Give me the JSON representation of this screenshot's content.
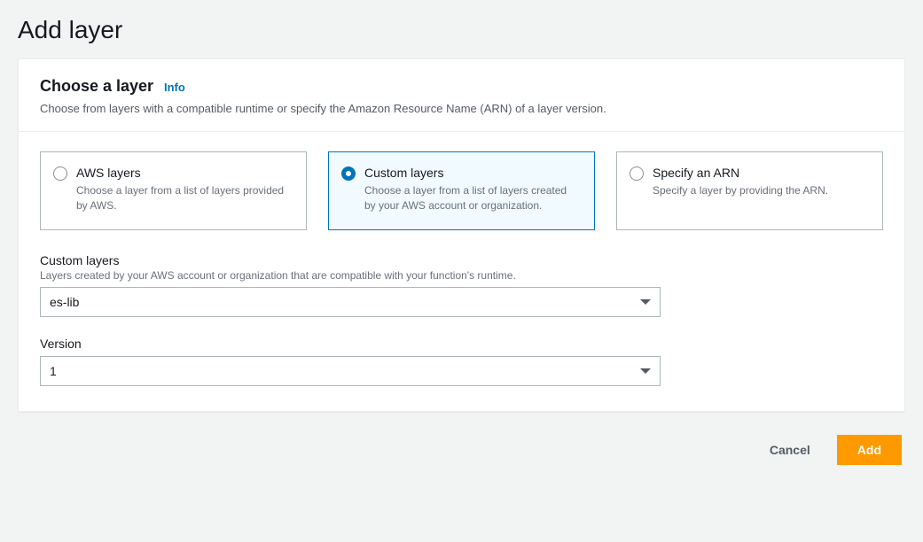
{
  "page": {
    "title": "Add layer"
  },
  "section": {
    "title": "Choose a layer",
    "info": "Info",
    "description": "Choose from layers with a compatible runtime or specify the Amazon Resource Name (ARN) of a layer version."
  },
  "options": {
    "aws": {
      "title": "AWS layers",
      "desc": "Choose a layer from a list of layers provided by AWS."
    },
    "custom": {
      "title": "Custom layers",
      "desc": "Choose a layer from a list of layers created by your AWS account or organization."
    },
    "arn": {
      "title": "Specify an ARN",
      "desc": "Specify a layer by providing the ARN."
    },
    "selected": "custom"
  },
  "fields": {
    "custom_layers": {
      "label": "Custom layers",
      "help": "Layers created by your AWS account or organization that are compatible with your function's runtime.",
      "value": "es-lib"
    },
    "version": {
      "label": "Version",
      "value": "1"
    }
  },
  "footer": {
    "cancel": "Cancel",
    "add": "Add"
  }
}
